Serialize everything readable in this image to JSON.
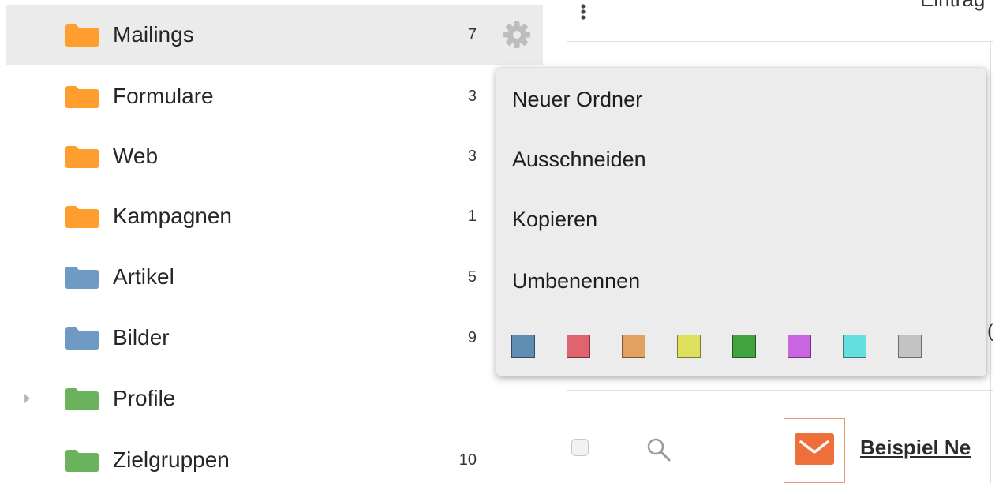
{
  "folders": [
    {
      "label": "Mailings",
      "count": "7",
      "color": "#ff9d2f",
      "selected": true,
      "expandable": false
    },
    {
      "label": "Formulare",
      "count": "3",
      "color": "#ff9d2f",
      "selected": false,
      "expandable": false
    },
    {
      "label": "Web",
      "count": "3",
      "color": "#ff9d2f",
      "selected": false,
      "expandable": false
    },
    {
      "label": "Kampagnen",
      "count": "1",
      "color": "#ff9d2f",
      "selected": false,
      "expandable": false
    },
    {
      "label": "Artikel",
      "count": "5",
      "color": "#6e9ac3",
      "selected": false,
      "expandable": false
    },
    {
      "label": "Bilder",
      "count": "9",
      "color": "#6e9ac3",
      "selected": false,
      "expandable": false
    },
    {
      "label": "Profile",
      "count": "",
      "color": "#6ab25c",
      "selected": false,
      "expandable": true
    },
    {
      "label": "Zielgruppen",
      "count": "10",
      "color": "#6ab25c",
      "selected": false,
      "expandable": false
    }
  ],
  "context_menu": {
    "items": [
      "Neuer Ordner",
      "Ausschneiden",
      "Kopieren",
      "Umbenennen"
    ],
    "swatches": [
      "#5f8cb3",
      "#df6470",
      "#e0a25e",
      "#e0e05f",
      "#3fa33f",
      "#c965e0",
      "#63dfe0",
      "#c3c3c3"
    ]
  },
  "right_panel": {
    "entries_label": "Eintrag",
    "partial_glyph": "(",
    "mail_title": "Beispiel Ne"
  }
}
